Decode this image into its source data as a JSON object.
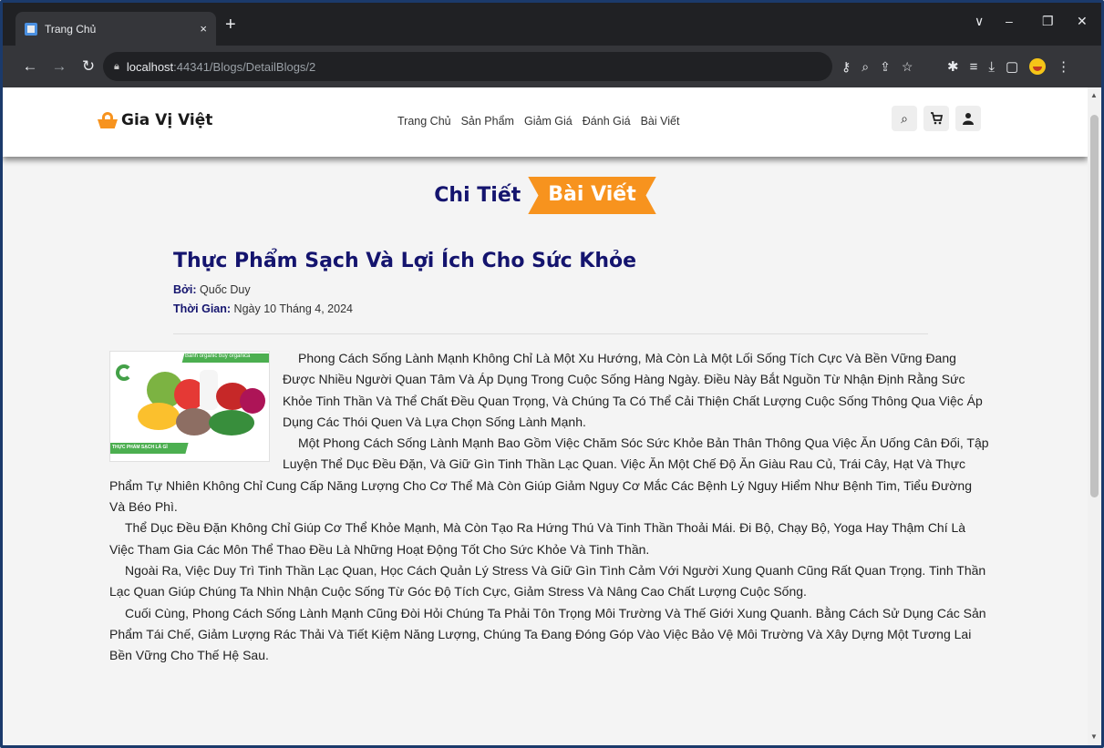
{
  "browser": {
    "tab_title": "Trang Chủ",
    "tab_close": "×",
    "new_tab": "+",
    "url_host": "localhost",
    "url_path": ":44341/Blogs/DetailBlogs/2",
    "window_controls": [
      "∨",
      "–",
      "❐",
      "✕"
    ]
  },
  "site": {
    "brand": "Gia Vị Việt",
    "accent_color": "#f7931e",
    "title_color": "#14146e",
    "nav": [
      "Trang Chủ",
      "Sản Phẩm",
      "Giảm Giá",
      "Đánh Giá",
      "Bài Viết"
    ],
    "header_icons": [
      "search-icon",
      "cart-icon",
      "user-icon"
    ]
  },
  "page": {
    "title_part1": "Chi Tiết",
    "title_part2": "Bài Viết"
  },
  "article": {
    "title": "Thực Phẩm Sạch Và Lợi Ích Cho Sức Khỏe",
    "author_label": "Bởi:",
    "author": "Quốc Duy",
    "time_label": "Thời Gian:",
    "time": "Ngày 10 Tháng 4, 2024",
    "image_caption_top": "Bánh organic buy organica",
    "image_caption_bottom": "THỰC PHẨM SẠCH LÀ GÌ",
    "paragraphs": [
      "Phong Cách Sống Lành Mạnh Không Chỉ Là Một Xu Hướng, Mà Còn Là Một Lối Sống Tích Cực Và Bền Vững Đang Được Nhiều Người Quan Tâm Và Áp Dụng Trong Cuộc Sống Hàng Ngày. Điều Này Bắt Nguồn Từ Nhận Định Rằng Sức Khỏe Tinh Thần Và Thể Chất Đều Quan Trọng, Và Chúng Ta Có Thể Cải Thiện Chất Lượng Cuộc Sống Thông Qua Việc Áp Dụng Các Thói Quen Và Lựa Chọn Sống Lành Mạnh.",
      "Một Phong Cách Sống Lành Mạnh Bao Gồm Việc Chăm Sóc Sức Khỏe Bản Thân Thông Qua Việc Ăn Uống Cân Đối, Tập Luyện Thể Dục Đều Đặn, Và Giữ Gìn Tinh Thần Lạc Quan. Việc Ăn Một Chế Độ Ăn Giàu Rau Củ, Trái Cây, Hạt Và Thực Phẩm Tự Nhiên Không Chỉ Cung Cấp Năng Lượng Cho Cơ Thể Mà Còn Giúp Giảm Nguy Cơ Mắc Các Bệnh Lý Nguy Hiểm Như Bệnh Tim, Tiểu Đường Và Béo Phì.",
      "Thể Dục Đều Đặn Không Chỉ Giúp Cơ Thể Khỏe Mạnh, Mà Còn Tạo Ra Hứng Thú Và Tinh Thần Thoải Mái. Đi Bộ, Chạy Bộ, Yoga Hay Thậm Chí Là Việc Tham Gia Các Môn Thể Thao Đều Là Những Hoạt Động Tốt Cho Sức Khỏe Và Tinh Thần.",
      "Ngoài Ra, Việc Duy Trì Tinh Thần Lạc Quan, Học Cách Quản Lý Stress Và Giữ Gìn Tình Cảm Với Người Xung Quanh Cũng Rất Quan Trọng. Tinh Thần Lạc Quan Giúp Chúng Ta Nhìn Nhận Cuộc Sống Từ Góc Độ Tích Cực, Giảm Stress Và Nâng Cao Chất Lượng Cuộc Sống.",
      "Cuối Cùng, Phong Cách Sống Lành Mạnh Cũng Đòi Hỏi Chúng Ta Phải Tôn Trọng Môi Trường Và Thế Giới Xung Quanh. Bằng Cách Sử Dụng Các Sản Phẩm Tái Chế, Giảm Lượng Rác Thải Và Tiết Kiệm Năng Lượng, Chúng Ta Đang Đóng Góp Vào Việc Bảo Vệ Môi Trường Và Xây Dựng Một Tương Lai Bền Vững Cho Thế Hệ Sau."
    ]
  }
}
